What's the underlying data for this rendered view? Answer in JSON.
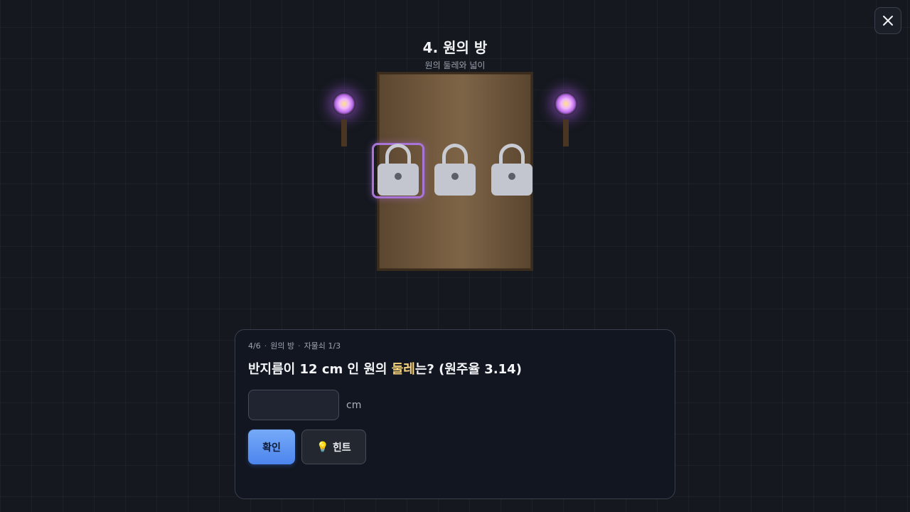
{
  "room": {
    "title": "4. 원의 방",
    "subtitle": "원의 둘레와 넓이"
  },
  "locks": [
    {
      "name": "lock-1",
      "selected": true
    },
    {
      "name": "lock-2",
      "selected": false
    },
    {
      "name": "lock-3",
      "selected": false
    }
  ],
  "panel": {
    "progress": "4/6",
    "room_name": "원의 방",
    "lock_progress": "자물쇠 1/3",
    "question_prefix": "반지름이 12 cm 인 원의 ",
    "question_highlight": "둘레",
    "question_suffix": "는? (원주율 3.14)",
    "answer_value": "",
    "unit": "cm",
    "confirm_label": "확인",
    "hint_label": "힌트"
  },
  "icons": {
    "close": "close-icon",
    "hint": "lightbulb-icon",
    "lock": "padlock-icon",
    "torch": "torch-icon"
  },
  "colors": {
    "accent": "#4c85ee",
    "highlight": "#f5d27a",
    "selection": "#a974d8",
    "door": "#7a6043"
  }
}
